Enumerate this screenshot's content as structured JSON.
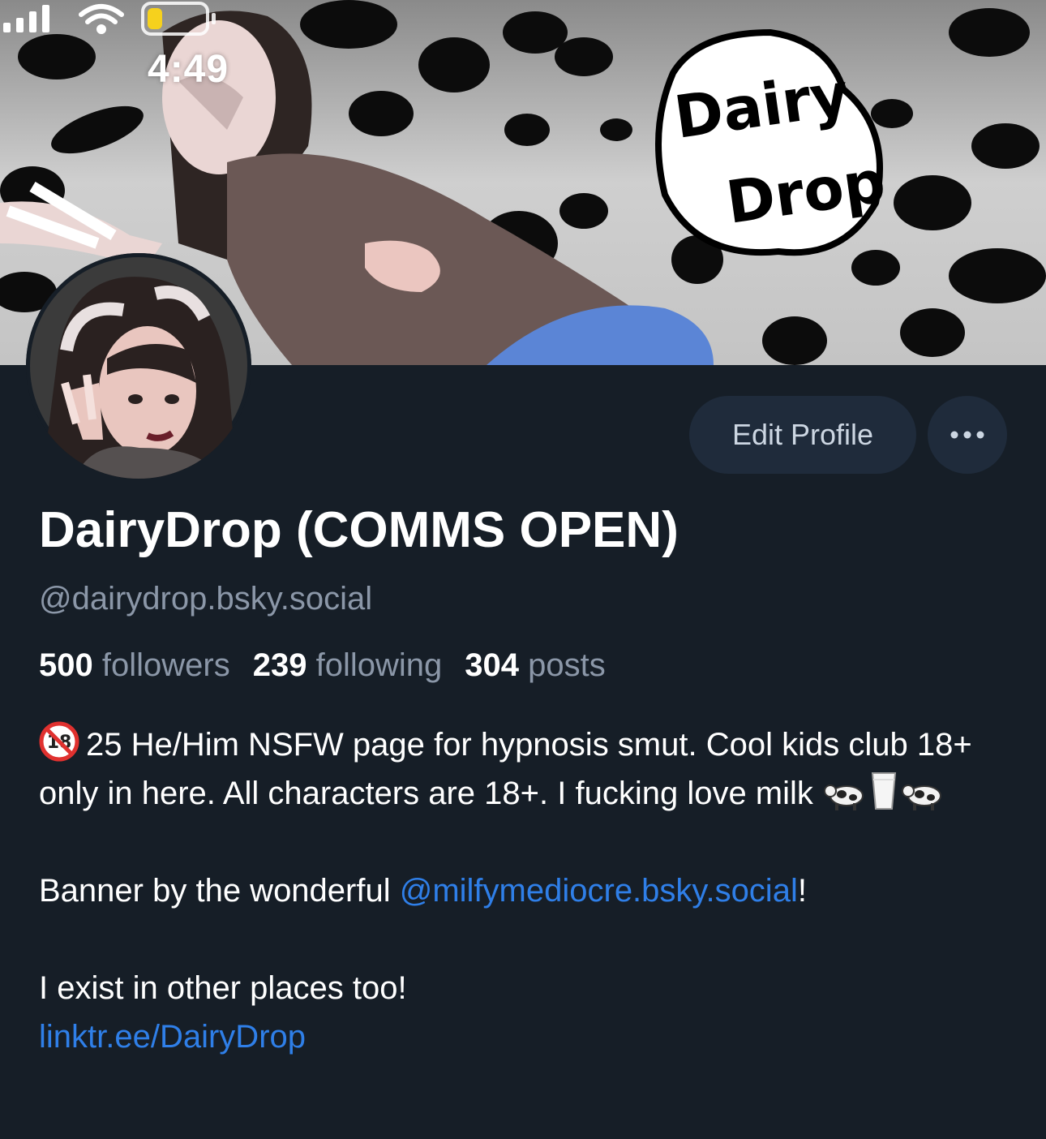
{
  "status_bar": {
    "time": "4:49"
  },
  "banner": {
    "logo_line1": "Dairy",
    "logo_line2": "Drop"
  },
  "profile": {
    "display_name": "DairyDrop (COMMS OPEN)",
    "handle": "@dairydrop.bsky.social",
    "edit_button_label": "Edit Profile",
    "more_button_icon": "ellipsis-icon"
  },
  "stats": {
    "followers_count": "500",
    "followers_label": "followers",
    "following_count": "239",
    "following_label": "following",
    "posts_count": "304",
    "posts_label": "posts"
  },
  "bio": {
    "line1": "25 He/Him NSFW page for hypnosis smut. Cool kids club 18+ only in here. All characters are 18+. I fucking love milk",
    "banner_credit_prefix": "Banner by the wonderful ",
    "banner_credit_link": "@milfymediocre.bsky.social",
    "banner_credit_suffix": "!",
    "other_places": "I exist in other places too!",
    "linktree": "linktr.ee/DairyDrop"
  },
  "colors": {
    "background": "#161e27",
    "button_bg": "#1f2b3b",
    "muted_text": "#8b97a8",
    "link": "#2f7fe8"
  }
}
